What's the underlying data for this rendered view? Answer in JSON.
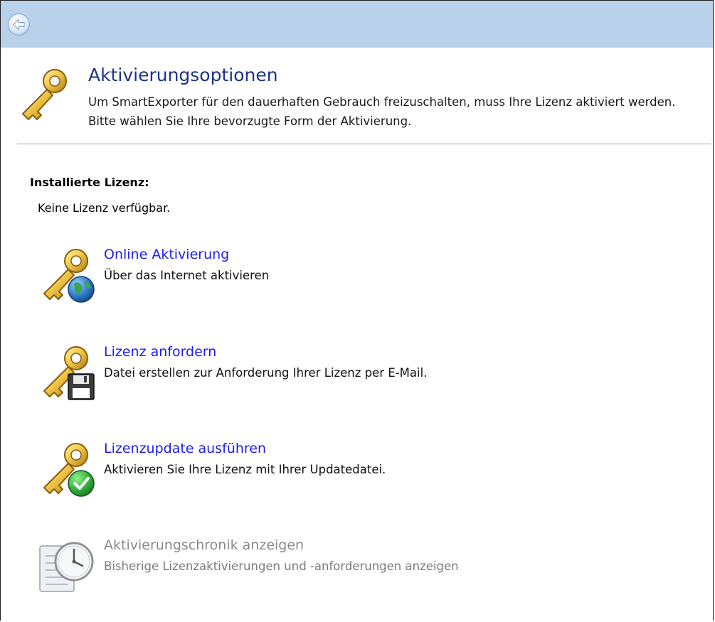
{
  "titlebar": {
    "back_icon": "back-arrow-icon",
    "color": "#b9d1ea"
  },
  "header": {
    "icon": "key-icon",
    "title": "Aktivierungsoptionen",
    "description": "Um SmartExporter für den dauerhaften Gebrauch freizuschalten, muss Ihre Lizenz aktiviert werden. Bitte wählen Sie Ihre bevorzugte Form der Aktivierung."
  },
  "license": {
    "label": "Installierte Lizenz:",
    "value": "Keine Lizenz verfügbar."
  },
  "options": [
    {
      "title": "Online Aktivierung",
      "description": "Über das Internet aktivieren",
      "icon": "key-globe-icon",
      "enabled": true
    },
    {
      "title": "Lizenz anfordern",
      "description": "Datei erstellen zur Anforderung Ihrer Lizenz per E-Mail.",
      "icon": "key-floppy-icon",
      "enabled": true
    },
    {
      "title": "Lizenzupdate ausführen",
      "description": "Aktivieren Sie Ihre Lizenz mit Ihrer Updatedatei.",
      "icon": "key-checkmark-icon",
      "enabled": true
    },
    {
      "title": "Aktivierungschronik anzeigen",
      "description": "Bisherige Lizenzaktivierungen und -anforderungen anzeigen",
      "icon": "clock-notebook-icon",
      "enabled": false
    }
  ],
  "colors": {
    "title": "#1e3287",
    "link": "#1d1df0",
    "disabled": "#8a8a8a",
    "key_gold": "#e0b13a"
  }
}
